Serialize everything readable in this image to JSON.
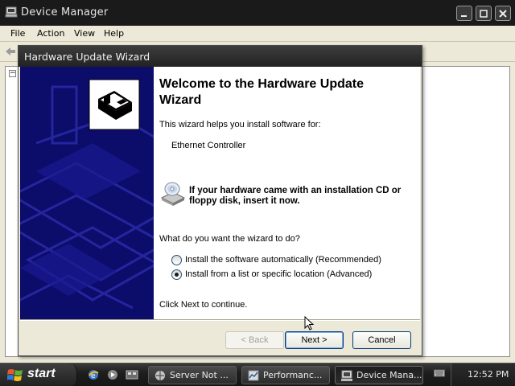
{
  "device_manager": {
    "title": "Device Manager",
    "menu": [
      "File",
      "Action",
      "View",
      "Help"
    ],
    "tree_toggle": "−"
  },
  "wizard": {
    "title": "Hardware Update Wizard",
    "heading": "Welcome to the Hardware Update Wizard",
    "intro": "This wizard helps you install software for:",
    "device": "Ethernet Controller",
    "cd_notice": "If your hardware came with an installation CD or floppy disk, insert it now.",
    "question": "What do you want the wizard to do?",
    "options": [
      {
        "label": "Install the software automatically (Recommended)",
        "selected": false
      },
      {
        "label": "Install from a list or specific location (Advanced)",
        "selected": true
      }
    ],
    "continue_hint": "Click Next to continue.",
    "buttons": {
      "back": "< Back",
      "next": "Next >",
      "cancel": "Cancel"
    }
  },
  "taskbar": {
    "start_label": "start",
    "tasks": [
      {
        "label": "Server Not ...",
        "icon": "browser-icon"
      },
      {
        "label": "Performanc...",
        "icon": "performance-icon"
      },
      {
        "label": "Device Mana...",
        "icon": "device-manager-icon",
        "active": true
      }
    ],
    "clock": "12:52 PM"
  },
  "colors": {
    "wizard_banner": "#0c0c6b",
    "taskbar": "#1e1e1e",
    "default_button_border": "#003c74"
  }
}
